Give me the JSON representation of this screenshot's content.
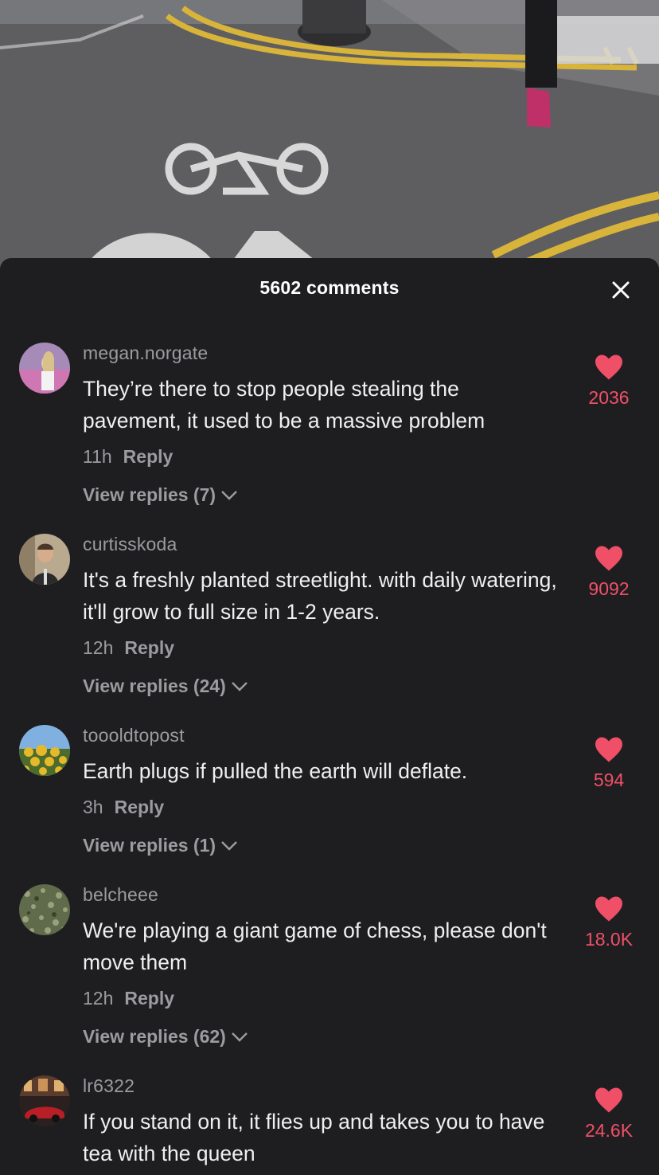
{
  "sheet": {
    "title": "5602 comments"
  },
  "icons": {
    "close": "close-icon",
    "like": "heart-icon",
    "expand": "chevron-down-icon"
  },
  "colors": {
    "like": "#f04f68",
    "background": "#1e1e20"
  },
  "comments": [
    {
      "username": "megan.norgate",
      "text": "They’re there to stop people stealing the pavement, it used to be a massive problem",
      "time": "11h",
      "reply_label": "Reply",
      "view_replies": "View replies (7)",
      "likes": "2036"
    },
    {
      "username": "curtisskoda",
      "text": "It's a freshly planted streetlight. with daily watering, it'll grow to full size in 1-2 years.",
      "time": "12h",
      "reply_label": "Reply",
      "view_replies": "View replies (24)",
      "likes": "9092"
    },
    {
      "username": "toooldtopost",
      "text": "Earth plugs if pulled the earth will deflate.",
      "time": "3h",
      "reply_label": "Reply",
      "view_replies": "View replies (1)",
      "likes": "594"
    },
    {
      "username": "belcheee",
      "text": "We're playing a giant game of chess, please don't move them",
      "time": "12h",
      "reply_label": "Reply",
      "view_replies": "View replies (62)",
      "likes": "18.0K"
    },
    {
      "username": "lr6322",
      "text": "If you stand on it, it flies up and takes you to have tea with the queen",
      "likes": "24.6K"
    }
  ]
}
